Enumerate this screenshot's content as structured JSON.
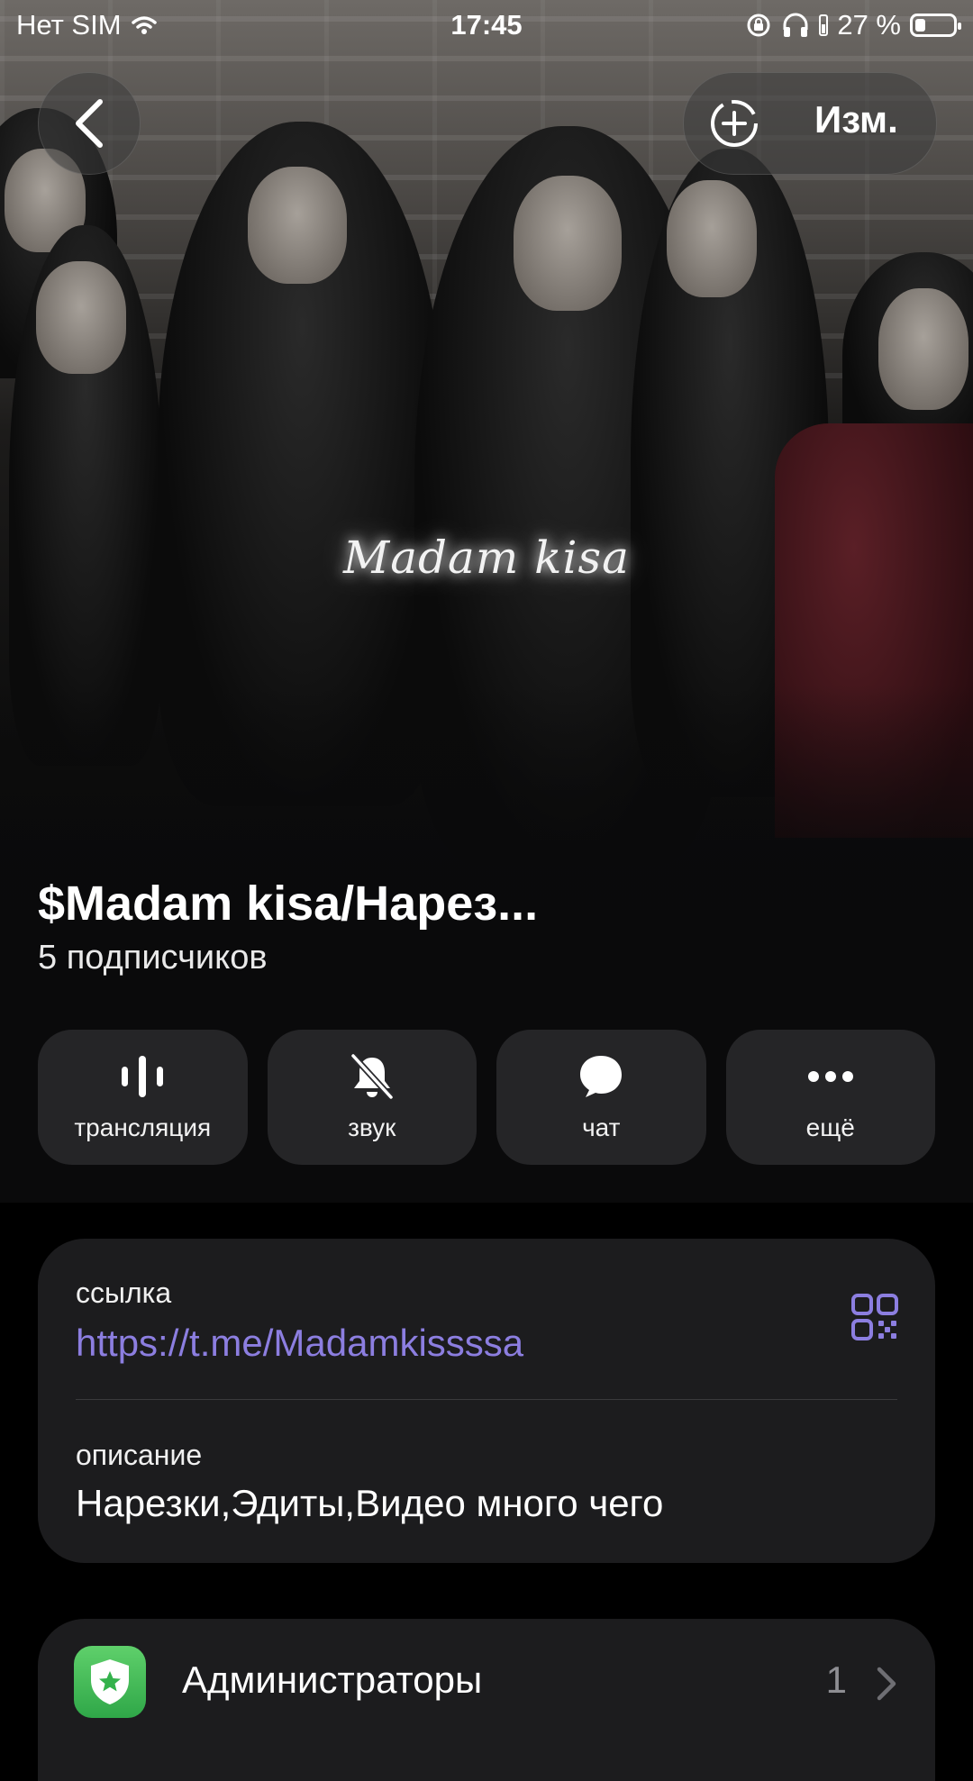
{
  "status_bar": {
    "carrier": "Нет SIM",
    "time": "17:45",
    "battery": "27 %",
    "battery_fraction": 0.27
  },
  "header": {
    "edit_label": "Изм."
  },
  "hero": {
    "watermark": "Madam kisa"
  },
  "channel": {
    "title": "$Madam kisa/Нарез...",
    "subscribers": "5 подписчиков"
  },
  "actions": [
    {
      "label": "трансляция",
      "icon": "broadcast-icon"
    },
    {
      "label": "звук",
      "icon": "bell-muted-icon"
    },
    {
      "label": "чат",
      "icon": "chat-bubble-icon"
    },
    {
      "label": "ещё",
      "icon": "more-icon"
    }
  ],
  "info": {
    "link_caption": "ссылка",
    "link": "https://t.me/Madamkissssa",
    "description_caption": "описание",
    "description": "Нарезки,Эдиты,Видео много чего"
  },
  "admins": {
    "label": "Администраторы",
    "count": "1"
  },
  "colors": {
    "accent_link": "#8c7ee0",
    "card_bg": "#1c1c1e",
    "shield_green": "#34b24c"
  }
}
